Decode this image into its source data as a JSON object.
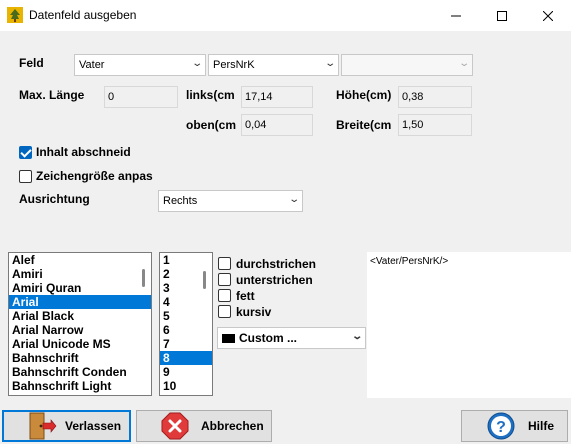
{
  "window": {
    "title": "Datenfeld ausgeben"
  },
  "labels": {
    "feld": "Feld",
    "max_laenge": "Max. Länge",
    "links": "links(cm",
    "oben": "oben(cm",
    "hoehe": "Höhe(cm)",
    "breite": "Breite(cm",
    "ausrichtung": "Ausrichtung"
  },
  "combos": {
    "feld1": "Vater",
    "feld2": "PersNrK",
    "feld3": "",
    "ausrichtung": "Rechts",
    "color": "Custom ..."
  },
  "inputs": {
    "max_laenge": "0",
    "links": "17,14",
    "oben": "0,04",
    "hoehe": "0,38",
    "breite": "1,50"
  },
  "checkboxes": {
    "inhalt": {
      "label": "Inhalt abschneid",
      "checked": true
    },
    "zeichengroesse": {
      "label": "Zeichengröße anpas",
      "checked": false
    },
    "durchstrichen": {
      "label": "durchstrichen",
      "checked": false
    },
    "unterstrichen": {
      "label": "unterstrichen",
      "checked": false
    },
    "fett": {
      "label": "fett",
      "checked": false
    },
    "kursiv": {
      "label": "kursiv",
      "checked": false
    }
  },
  "fonts": {
    "items": [
      "Alef",
      "Amiri",
      "Amiri Quran",
      "Arial",
      "Arial Black",
      "Arial Narrow",
      "Arial Unicode MS",
      "Bahnschrift",
      "Bahnschrift Conden",
      "Bahnschrift Light"
    ],
    "selected": "Arial"
  },
  "sizes": {
    "items": [
      "1",
      "2",
      "3",
      "4",
      "5",
      "6",
      "7",
      "8",
      "9",
      "10"
    ],
    "selected": "8"
  },
  "preview": {
    "text": "<Vater/PersNrK/>"
  },
  "buttons": {
    "verlassen": "Verlassen",
    "abbrechen": "Abbrechen",
    "hilfe": "Hilfe"
  },
  "colors": {
    "accent": "#0078d7",
    "check": "#0067c0",
    "abbrechen_icon": "#e03a3a",
    "hilfe_icon": "#1e6fc2"
  }
}
